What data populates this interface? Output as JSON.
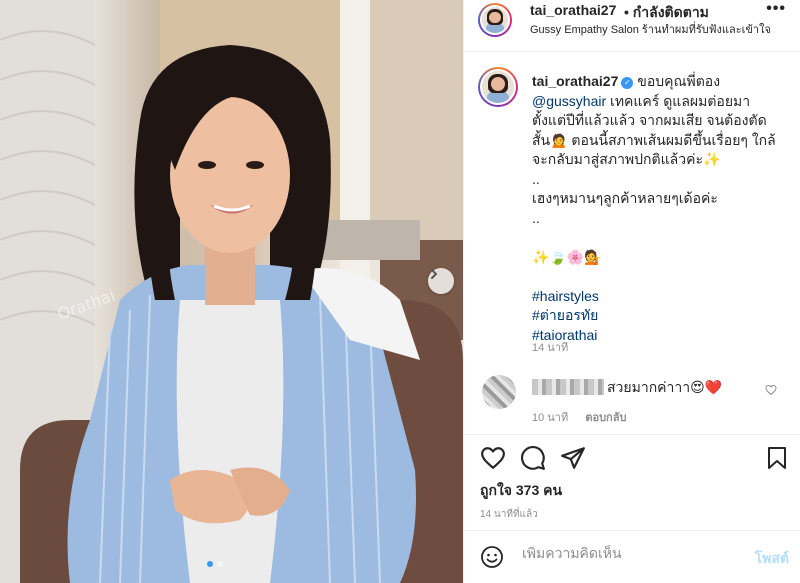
{
  "header": {
    "username": "tai_orathai27",
    "follow_label": "• กำลังติดตาม",
    "location": "Gussy Empathy Salon ร้านทำผมที่รับฟังและเข้าใจ",
    "more_label": "•••"
  },
  "photo": {
    "watermark": "Orathai"
  },
  "caption": {
    "username": "tai_orathai27",
    "lines": [
      "ขอบคุณพี่ตอง",
      "@gussyhair เทคแคร์ ดูแลผมต่อยมา",
      "ตั้งแต่ปีที่แล้วแล้ว จากผมเสีย จนต้องตัด",
      "สั้น🙍 ตอนนี้สภาพเส้นผมดีขึ้นเรื่อยๆ ใกล้",
      "จะกลับมาสู่สภาพปกติแล้วค่ะ✨",
      "..",
      "เฮงๆหมานๆลูกค้าหลายๆเด้อค่ะ",
      "..",
      "",
      "✨🍃🌸💁",
      "",
      "#hairstyles",
      "#ต่ายอรทัย",
      "#taiorathai"
    ],
    "mention": "@gussyhair",
    "time": "14 นาที"
  },
  "comment": {
    "text": "สวยมากค่าาา😍❤️",
    "time": "10 นาที",
    "reply_label": "ตอบกลับ"
  },
  "actions": {
    "likes": "ถูกใจ 373 คน",
    "posted": "14 นาทีที่แล้ว"
  },
  "add_comment": {
    "placeholder": "เพิ่มความคิดเห็น",
    "post_label": "โพสต์"
  },
  "colors": {
    "link": "#00376b",
    "verified": "#3897f0",
    "post_disabled": "#b2dffc",
    "shirt": "#9dbbe0"
  }
}
